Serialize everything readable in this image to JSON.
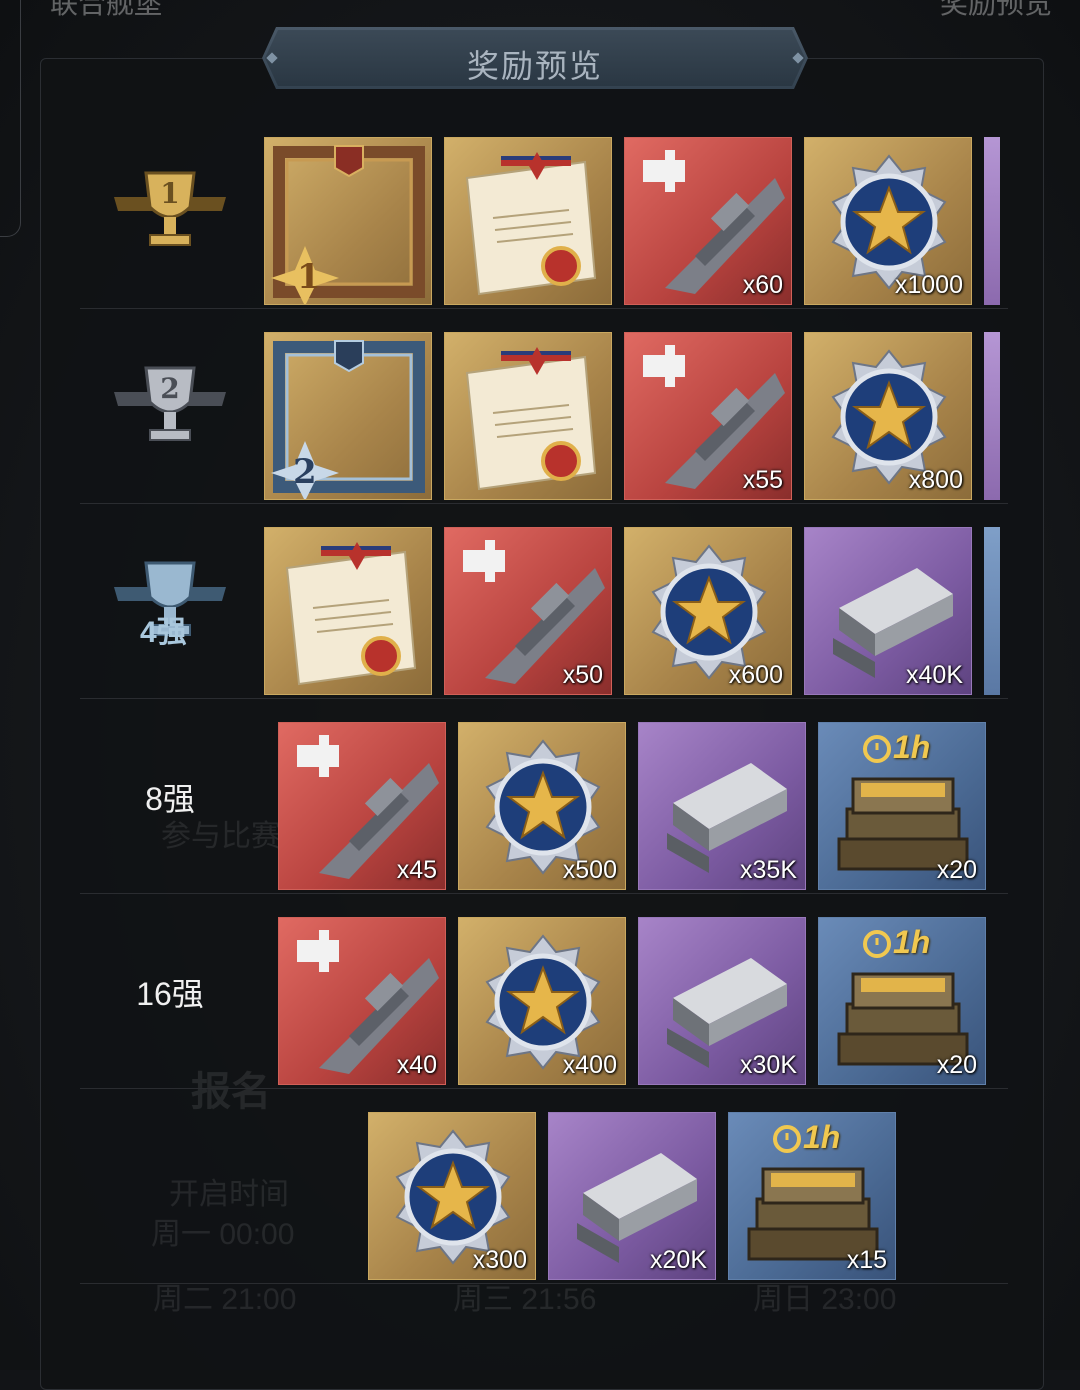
{
  "header": {
    "title": "奖励预览",
    "top_left_partial": "联合舰堡",
    "top_right_partial": "奖励预览"
  },
  "background": {
    "ghost_labels": [
      "参与比赛",
      "报名",
      "开启时间",
      "周一 00:00",
      "周二 21:00",
      "周三 21:56",
      "周日 23:00",
      "1h"
    ]
  },
  "rows": [
    {
      "rank_label": "",
      "rank_icon": "trophy-rank-1-badge-icon",
      "items": [
        {
          "icon": "gold-frame-rank-1-icon",
          "bg": "gold",
          "qty": ""
        },
        {
          "icon": "commendation-certificate-icon",
          "bg": "gold",
          "qty": ""
        },
        {
          "icon": "battleship-fragment-icon",
          "bg": "red",
          "qty": "x60"
        },
        {
          "icon": "star-medal-icon",
          "bg": "gold",
          "qty": "x1000"
        }
      ],
      "overflow": "purple"
    },
    {
      "rank_label": "",
      "rank_icon": "trophy-rank-2-badge-icon",
      "items": [
        {
          "icon": "silver-frame-rank-2-icon",
          "bg": "gold",
          "qty": ""
        },
        {
          "icon": "commendation-certificate-icon",
          "bg": "gold",
          "qty": ""
        },
        {
          "icon": "battleship-fragment-icon",
          "bg": "red",
          "qty": "x55"
        },
        {
          "icon": "star-medal-icon",
          "bg": "gold",
          "qty": "x800"
        }
      ],
      "overflow": "purple"
    },
    {
      "rank_label": "4强",
      "rank_icon": "trophy-top-4-badge-icon",
      "items": [
        {
          "icon": "commendation-certificate-icon",
          "bg": "gold",
          "qty": ""
        },
        {
          "icon": "battleship-fragment-icon",
          "bg": "red",
          "qty": "x50"
        },
        {
          "icon": "star-medal-icon",
          "bg": "gold",
          "qty": "x600"
        },
        {
          "icon": "steel-ingot-icon",
          "bg": "purple",
          "qty": "x40K"
        }
      ],
      "overflow": "blue"
    },
    {
      "rank_label": "8强",
      "items": [
        {
          "icon": "battleship-fragment-icon",
          "bg": "red",
          "qty": "x45"
        },
        {
          "icon": "star-medal-icon",
          "bg": "gold",
          "qty": "x500"
        },
        {
          "icon": "steel-ingot-icon",
          "bg": "purple",
          "qty": "x35K"
        },
        {
          "icon": "speedup-crate-1h-icon",
          "bg": "blue",
          "qty": "x20",
          "tag": "1h"
        }
      ]
    },
    {
      "rank_label": "16强",
      "items": [
        {
          "icon": "battleship-fragment-icon",
          "bg": "red",
          "qty": "x40"
        },
        {
          "icon": "star-medal-icon",
          "bg": "gold",
          "qty": "x400"
        },
        {
          "icon": "steel-ingot-icon",
          "bg": "purple",
          "qty": "x30K"
        },
        {
          "icon": "speedup-crate-1h-icon",
          "bg": "blue",
          "qty": "x20",
          "tag": "1h"
        }
      ]
    },
    {
      "rank_label": "",
      "items": [
        {
          "icon": "star-medal-icon",
          "bg": "gold",
          "qty": "x300"
        },
        {
          "icon": "steel-ingot-icon",
          "bg": "purple",
          "qty": "x20K"
        },
        {
          "icon": "speedup-crate-1h-icon",
          "bg": "blue",
          "qty": "x15",
          "tag": "1h"
        }
      ]
    }
  ]
}
